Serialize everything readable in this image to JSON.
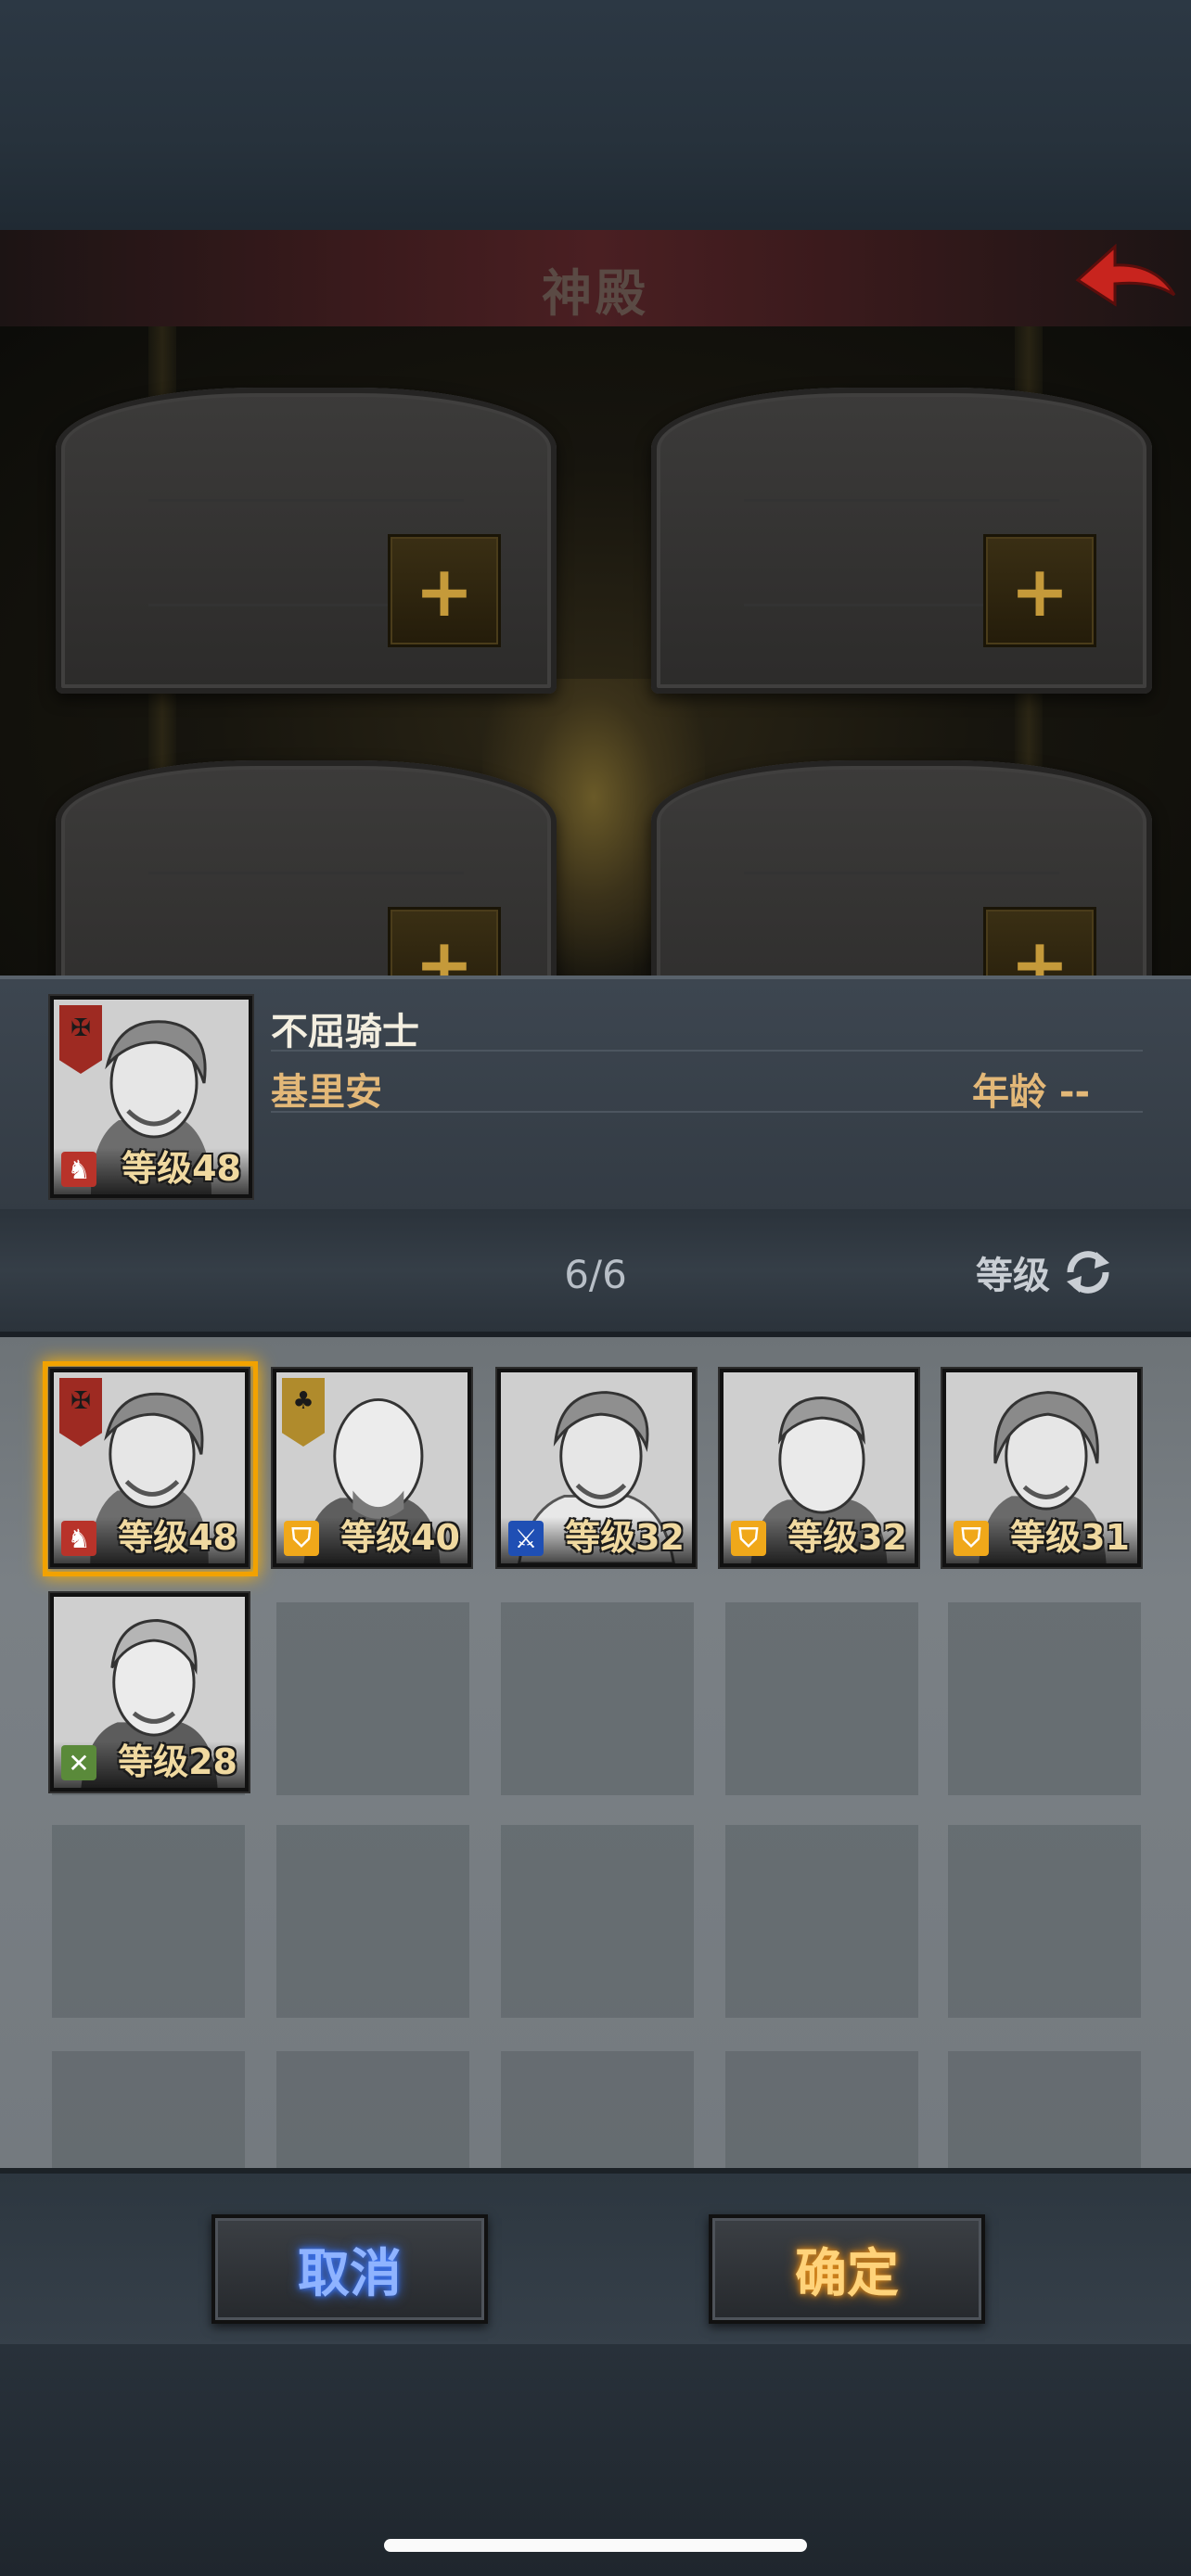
{
  "header": {
    "title": "神殿"
  },
  "hall": {
    "slots": [
      "+",
      "+",
      "+",
      "+"
    ]
  },
  "selected": {
    "name": "不屈骑士",
    "hero_name": "基里安",
    "age_label": "年龄 --",
    "level_label": "等级48"
  },
  "list": {
    "count": "6/6",
    "sort_label": "等级",
    "heroes": [
      {
        "level_label": "等级48",
        "class_icon": "horse-icon",
        "banner": "red-banner-icon",
        "selected": true
      },
      {
        "level_label": "等级40",
        "class_icon": "shield-icon",
        "banner": "gold-tree-banner-icon",
        "selected": false
      },
      {
        "level_label": "等级32",
        "class_icon": "sword-icon",
        "banner": null,
        "selected": false
      },
      {
        "level_label": "等级32",
        "class_icon": "shield-icon",
        "banner": null,
        "selected": false
      },
      {
        "level_label": "等级31",
        "class_icon": "shield-icon",
        "banner": null,
        "selected": false
      },
      {
        "level_label": "等级28",
        "class_icon": "crossed-arrows-icon",
        "banner": null,
        "selected": false
      }
    ]
  },
  "actions": {
    "cancel": "取消",
    "confirm": "确定"
  },
  "colors": {
    "gold_text": "#e3b878",
    "cancel_glow": "#3a76ff",
    "confirm_glow": "#e08a18",
    "selection": "#f2a200"
  }
}
